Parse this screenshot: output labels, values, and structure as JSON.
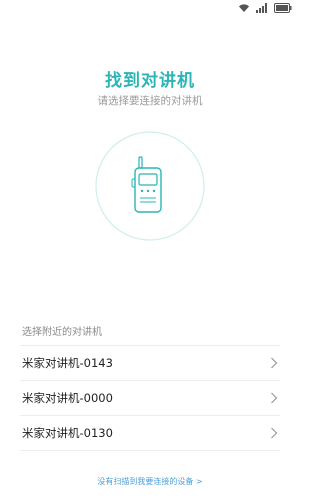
{
  "header": {
    "title": "找到对讲机",
    "subtitle": "请选择要连接的对讲机"
  },
  "status_bar": {
    "icons": [
      "wifi-icon",
      "signal-icon",
      "battery-icon"
    ]
  },
  "device_icon": "walkie-talkie-icon",
  "colors": {
    "accent": "#2bb5b5",
    "circle_stroke": "#cfeeed",
    "link": "#4a9fd8"
  },
  "section": {
    "label": "选择附近的对讲机"
  },
  "devices": [
    {
      "name": "米家对讲机-0143"
    },
    {
      "name": "米家对讲机-0000"
    },
    {
      "name": "米家对讲机-0130"
    }
  ],
  "footer": {
    "link_label": "没有扫描到我要连接的设备 >"
  }
}
